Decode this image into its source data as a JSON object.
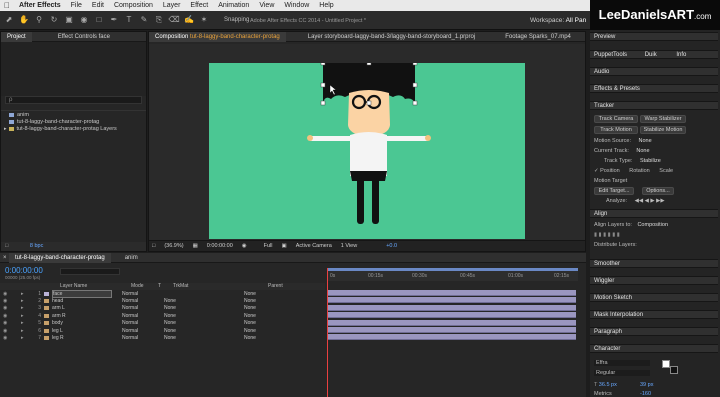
{
  "menubar": {
    "app": "After Effects",
    "items": [
      "File",
      "Edit",
      "Composition",
      "Layer",
      "Effect",
      "Animation",
      "View",
      "Window",
      "Help"
    ]
  },
  "toolbar": {
    "snapping": "Snapping",
    "window_title": "Adobe After Effects CC 2014 - Untitled Project *",
    "workspace_label": "Workspace:",
    "workspace_value": "All Pan"
  },
  "logo": {
    "part1": "LeeDaniels",
    "part2": "ART",
    "part3": ".com"
  },
  "project_panel": {
    "tab": "Project",
    "tab2": "Effect Controls face",
    "search_placeholder": "ρ",
    "items": [
      {
        "name": "anim",
        "type": "comp"
      },
      {
        "name": "tut-8-laggy-band-character-protag",
        "type": "comp"
      },
      {
        "name": "tut-8-laggy-band-character-protag Layers",
        "type": "folder"
      }
    ],
    "bpc": "8 bpc"
  },
  "comp_viewer": {
    "tab_label": "Composition",
    "tab_comp": "tut-8-laggy-band-character-protag",
    "tab2": "Layer storyboard-laggy-band-3/laggy-band-storyboard_1.prproj",
    "tab3": "Footage Sparks_07.mp4",
    "sub_tab": "tut-8-laggy-band-character-protag",
    "zoom": "(36.9%)",
    "timecode": "0:00:00:00",
    "resolution": "Full",
    "camera": "Active Camera",
    "views": "1 View",
    "exposure": "+0.0"
  },
  "timeline": {
    "tab1": "tut-8-laggy-band-character-protag",
    "tab2": "anim",
    "timecode": "0:00:00:00",
    "fps": "00000 (25.00 fps)",
    "col_layer": "Layer Name",
    "col_mode": "Mode",
    "col_t": "T",
    "col_trkmat": "TrkMat",
    "col_parent": "Parent",
    "ruler": [
      "0s",
      "00:15s",
      "00:30s",
      "00:45s",
      "01:00s",
      "01:15s",
      "02:15s"
    ],
    "layers": [
      {
        "num": "1",
        "name": "face",
        "mode": "Normal",
        "trk": "",
        "parent": "None",
        "color": "#b9b2d6"
      },
      {
        "num": "2",
        "name": "head",
        "mode": "Normal",
        "trk": "None",
        "parent": "None",
        "color": "#c7a06a"
      },
      {
        "num": "3",
        "name": "arm L",
        "mode": "Normal",
        "trk": "None",
        "parent": "None",
        "color": "#c7a06a"
      },
      {
        "num": "4",
        "name": "arm R",
        "mode": "Normal",
        "trk": "None",
        "parent": "None",
        "color": "#c7a06a"
      },
      {
        "num": "5",
        "name": "body",
        "mode": "Normal",
        "trk": "None",
        "parent": "None",
        "color": "#c7a06a"
      },
      {
        "num": "6",
        "name": "leg L",
        "mode": "Normal",
        "trk": "None",
        "parent": "None",
        "color": "#c7a06a"
      },
      {
        "num": "7",
        "name": "leg R",
        "mode": "Normal",
        "trk": "None",
        "parent": "None",
        "color": "#c7a06a"
      }
    ]
  },
  "right_panel": {
    "preview": "Preview",
    "tabs": [
      "PuppetTools",
      "Duik",
      "Info"
    ],
    "audio": "Audio",
    "effects_presets": "Effects & Presets",
    "tracker": {
      "title": "Tracker",
      "btn_track_camera": "Track Camera",
      "btn_warp": "Warp Stabilizer",
      "btn_track_motion": "Track Motion",
      "btn_stabilize": "Stabilize Motion",
      "motion_source_label": "Motion Source:",
      "motion_source": "None",
      "current_track_label": "Current Track:",
      "current_track": "None",
      "track_type_label": "Track Type:",
      "track_type": "Stabilize",
      "position": "Position",
      "rotation": "Rotation",
      "scale": "Scale",
      "motion_target": "Motion Target",
      "edit_target": "Edit Target...",
      "options": "Options...",
      "analyze": "Analyze:"
    },
    "align": {
      "title": "Align",
      "align_to_label": "Align Layers to:",
      "align_to": "Composition",
      "distribute": "Distribute Layers:"
    },
    "smoother": "Smoother",
    "wiggler": "Wiggler",
    "motion_sketch": "Motion Sketch",
    "mask_interpolation": "Mask Interpolation",
    "paragraph": "Paragraph",
    "character": {
      "title": "Character",
      "font": "Effra",
      "style": "Regular",
      "size": "36.5 px",
      "leading": "39 px",
      "kerning": "Metrics",
      "tracking": "-160"
    }
  }
}
